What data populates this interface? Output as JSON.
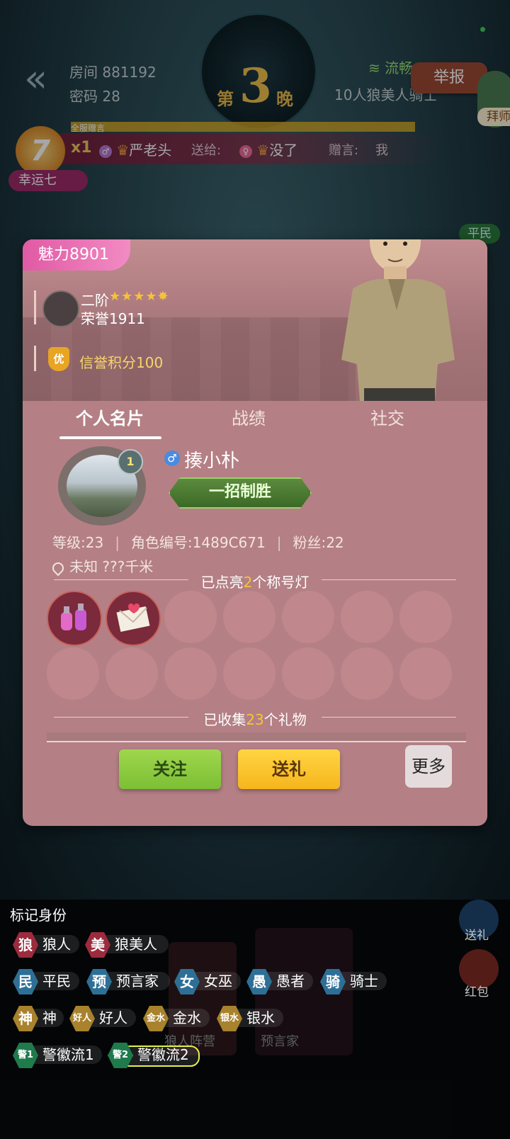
{
  "header": {
    "room": "房间 881192",
    "password": "密码 28",
    "night_prefix": "第",
    "night_number": "3",
    "night_suffix": "晚",
    "network": "流畅",
    "mode": "10人狼美人骑士",
    "report": "举报",
    "master": "拜师"
  },
  "gift_banner": {
    "tag": "全服赠言",
    "badge_number": "7",
    "badge_label": "幸运七",
    "count": "x1",
    "from": "严老头",
    "send_to": "送给:",
    "to": "没了",
    "message_label": "赠言:",
    "message": "我"
  },
  "side": {
    "civilian_tag": "平民"
  },
  "profile": {
    "charm": "魅力8901",
    "rank": "二阶",
    "stars": "★★★★✸",
    "honor": "荣誉1911",
    "credit_icon": "优",
    "credit": "信誉积分100",
    "tabs": [
      {
        "label": "个人名片",
        "active": true
      },
      {
        "label": "战绩",
        "active": false
      },
      {
        "label": "社交",
        "active": false
      }
    ],
    "level_badge": "1",
    "gender": "♂",
    "nickname": "揍小朴",
    "title": "一招制胜",
    "level": "等级:23",
    "role_id": "角色编号:1489C671",
    "fans": "粉丝:22",
    "location": "未知 ???千米",
    "titles_section": {
      "pre": "已点亮",
      "count": "2",
      "post": "个称号灯"
    },
    "gifts_section": {
      "pre": "已收集",
      "count": "23",
      "post": "个礼物"
    },
    "follow": "关注",
    "send_gift": "送礼",
    "more": "更多"
  },
  "mark": {
    "title": "标记身份",
    "rows": [
      [
        {
          "icon": "狼",
          "label": "狼人",
          "type": "wolf"
        },
        {
          "icon": "美",
          "label": "狼美人",
          "type": "wolf"
        }
      ],
      [
        {
          "icon": "民",
          "label": "平民",
          "type": "good"
        },
        {
          "icon": "预",
          "label": "预言家",
          "type": "good"
        },
        {
          "icon": "女",
          "label": "女巫",
          "type": "good"
        },
        {
          "icon": "愚",
          "label": "愚者",
          "type": "good"
        },
        {
          "icon": "骑",
          "label": "骑士",
          "type": "good"
        }
      ],
      [
        {
          "icon": "神",
          "label": "神",
          "type": "gold"
        },
        {
          "icon": "好人",
          "label": "好人",
          "type": "gold"
        },
        {
          "icon": "金水",
          "label": "金水",
          "type": "gold"
        },
        {
          "icon": "银水",
          "label": "银水",
          "type": "gold"
        }
      ],
      [
        {
          "icon": "警1",
          "label": "警徽流1",
          "type": "green"
        },
        {
          "icon": "警2",
          "label": "警徽流2",
          "type": "green",
          "selected": true
        }
      ]
    ],
    "right_send": "送礼",
    "right_red": "红包"
  },
  "background": {
    "camp_label": "狼人阵营",
    "seer_label": "预言家"
  },
  "colors": {
    "accent_pink": "#e05aa4",
    "follow_green": "#9fd64c",
    "send_yellow": "#ffd542",
    "modal_bg": "#b48085"
  }
}
